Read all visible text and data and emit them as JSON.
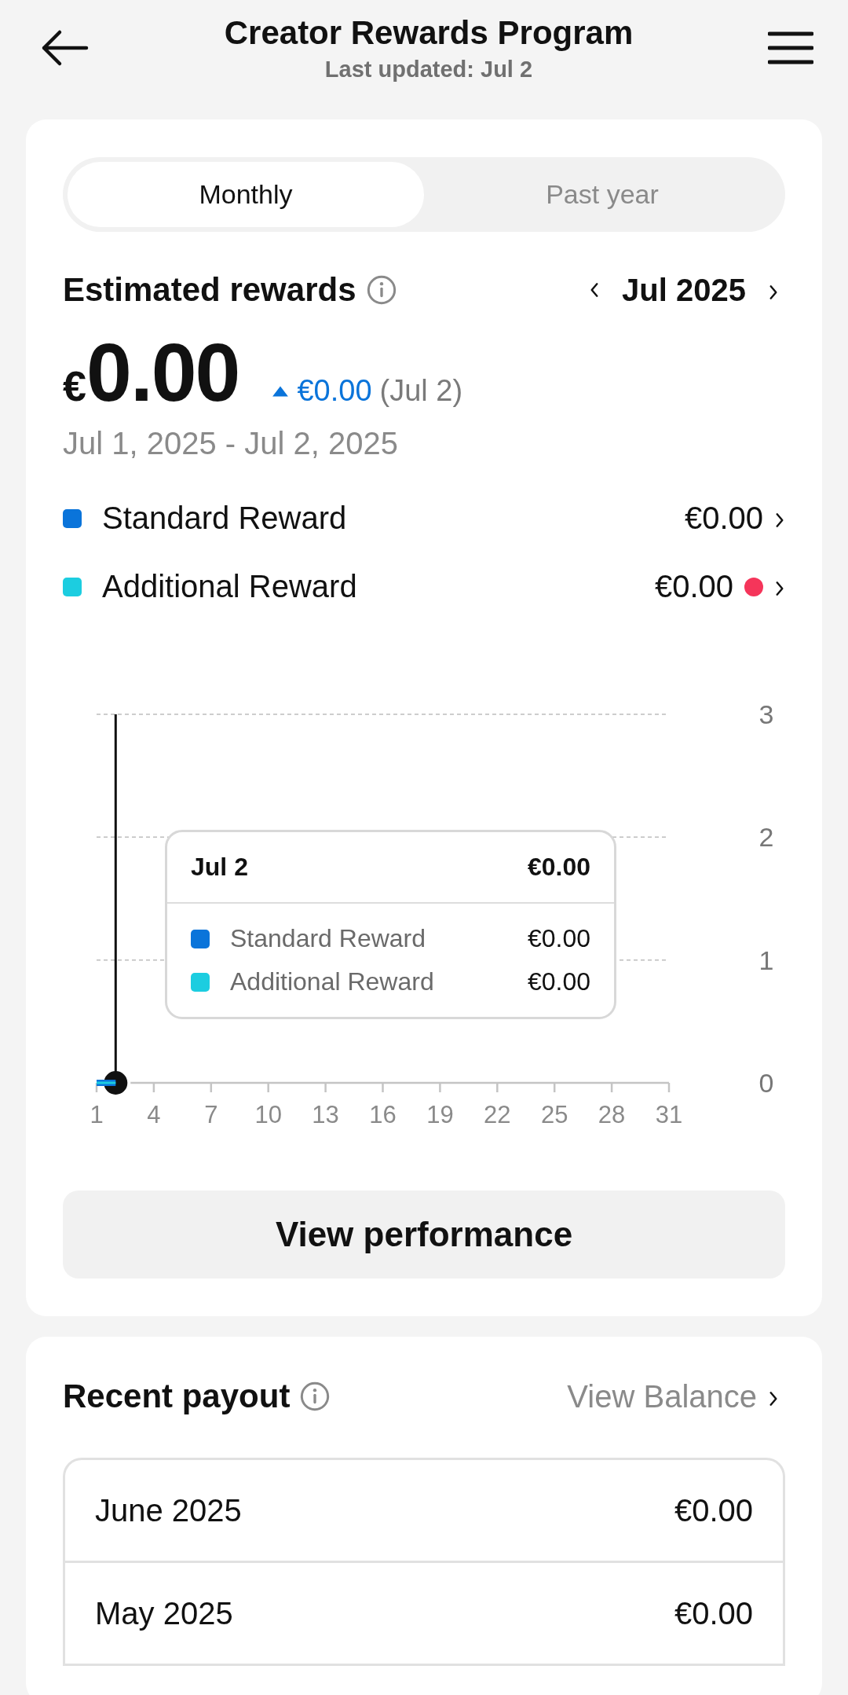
{
  "header": {
    "title": "Creator Rewards Program",
    "subtitle": "Last updated: Jul 2"
  },
  "tabs": [
    {
      "label": "Monthly",
      "selected": true
    },
    {
      "label": "Past year",
      "selected": false
    }
  ],
  "rewards": {
    "title": "Estimated rewards",
    "period": "Jul 2025",
    "currency": "€",
    "amount": "0.00",
    "change": "€0.00",
    "change_date": "(Jul 2)",
    "range": "Jul 1, 2025 - Jul 2, 2025",
    "items": [
      {
        "label": "Standard Reward",
        "value": "€0.00",
        "color": "#0a74da",
        "alert": false
      },
      {
        "label": "Additional Reward",
        "value": "€0.00",
        "color": "#1ccde0",
        "alert": true
      }
    ],
    "chart_data": {
      "type": "line",
      "x": [
        1,
        2
      ],
      "series": [
        {
          "name": "Standard Reward",
          "color": "#0a74da",
          "values": [
            0,
            0
          ]
        },
        {
          "name": "Additional Reward",
          "color": "#1ccde0",
          "values": [
            0,
            0
          ]
        }
      ],
      "legend": "center",
      "ref_lines": [
        {
          "axis": "x",
          "value": 2
        }
      ],
      "xlim": [
        1,
        31
      ],
      "ylim": [
        0,
        3
      ],
      "xticks": [
        1,
        4,
        7,
        10,
        13,
        16,
        19,
        22,
        25,
        28,
        31
      ],
      "yticks": [
        0,
        1,
        2,
        3
      ]
    },
    "tooltip": {
      "date": "Jul 2",
      "total": "€0.00",
      "rows": [
        {
          "value": "€0.00"
        },
        {
          "value": "€0.00"
        }
      ]
    },
    "button": "View performance"
  },
  "payout": {
    "title": "Recent payout",
    "link": "View Balance",
    "rows": [
      {
        "month": "June 2025",
        "amount": "€0.00"
      },
      {
        "month": "May 2025",
        "amount": "€0.00"
      }
    ]
  }
}
